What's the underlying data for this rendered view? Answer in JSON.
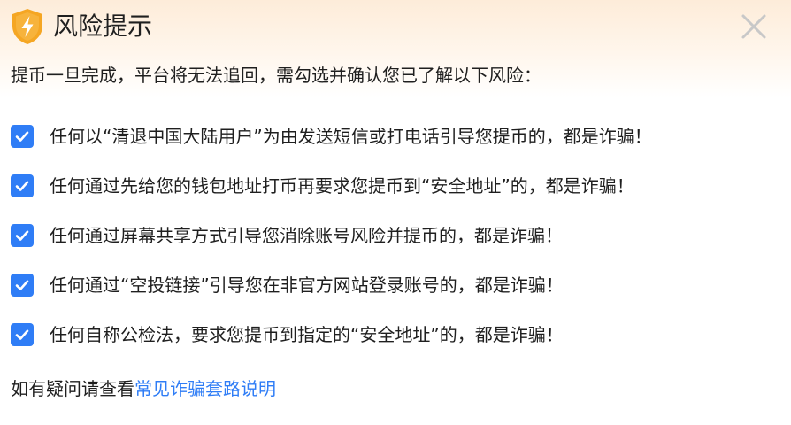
{
  "dialog": {
    "title": "风险提示",
    "intro": "提币一旦完成，平台将无法追回，需勾选并确认您已了解以下风险：",
    "items": [
      {
        "label": "任何以“清退中国大陆用户”为由发送短信或打电话引导您提币的，都是诈骗！",
        "checked": true
      },
      {
        "label": "任何通过先给您的钱包地址打币再要求您提币到“安全地址”的，都是诈骗！",
        "checked": true
      },
      {
        "label": "任何通过屏幕共享方式引导您消除账号风险并提币的，都是诈骗！",
        "checked": true
      },
      {
        "label": "任何通过“空投链接”引导您在非官方网站登录账号的，都是诈骗！",
        "checked": true
      },
      {
        "label": "任何自称公检法，要求您提币到指定的“安全地址”的，都是诈骗！",
        "checked": true
      }
    ],
    "footer": {
      "text": "如有疑问请查看",
      "link_label": "常见诈骗套路说明"
    }
  },
  "icons": {
    "warning": "shield-lightning-icon",
    "close": "close-icon",
    "check": "checkmark-icon"
  },
  "colors": {
    "accent": "#2f7df6",
    "warning_orange": "#f5a623",
    "header_gradient": "#fdecd9",
    "close_gray": "#c8c8c8"
  }
}
